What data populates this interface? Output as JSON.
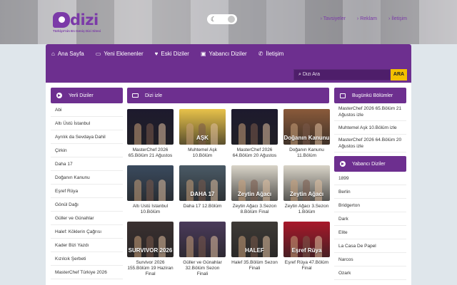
{
  "header": {
    "logo_text": "dizi",
    "logo_tagline": "Türkiye'nin En Geniş Dizi Sitesi",
    "top_links": [
      "Tavsiyeler",
      "Reklam",
      "İletişim"
    ]
  },
  "nav": {
    "items": [
      {
        "label": "Ana Sayfa",
        "icon": "home-icon"
      },
      {
        "label": "Yeni Eklenenler",
        "icon": "monitor-icon"
      },
      {
        "label": "Eski Diziler",
        "icon": "heart-icon"
      },
      {
        "label": "Yabancı Diziler",
        "icon": "camera-icon"
      },
      {
        "label": "İletişim",
        "icon": "phone-icon"
      }
    ],
    "search_placeholder": "Dizi Ara",
    "search_button": "ARA"
  },
  "left_sidebar": {
    "title": "Yerli Diziler",
    "items": [
      "Abi",
      "Altı Üstü İstanbul",
      "Ayrılık da Sevdaya Dahil",
      "Çirkin",
      "Daha 17",
      "Doğanın Kanunu",
      "Eşref Rüya",
      "Gönül Dağı",
      "Güller ve Günahlar",
      "Halef: Köklerin Çağrısı",
      "Kader Bizi Yazdı",
      "Kızılcık Şerbeti",
      "MasterChef Türkiye 2026"
    ]
  },
  "center": {
    "title": "Dizi izle",
    "cards": [
      {
        "title": "MasterChef 2026 65.Bölüm 21 Ağustos",
        "thumb_text": "",
        "color": "#1d1a2e"
      },
      {
        "title": "Muhtemel Aşk 10.Bölüm",
        "thumb_text": "AŞK",
        "color": "#e8c24a"
      },
      {
        "title": "MasterChef 2026 64.Bölüm 20 Ağustos",
        "thumb_text": "",
        "color": "#1d1a2e"
      },
      {
        "title": "Doğanın Kanunu 11.Bölüm",
        "thumb_text": "Doğanın Kanunu",
        "color": "#8a5a3a"
      },
      {
        "title": "Altı Üstü İstanbul 10.Bölüm",
        "thumb_text": "",
        "color": "#3a4a5e"
      },
      {
        "title": "Daha 17 12.Bölüm",
        "thumb_text": "DAHA 17",
        "color": "#4a5a66"
      },
      {
        "title": "Zeytin Ağacı 3.Sezon 8.Bölüm Final",
        "thumb_text": "Zeytin Ağacı",
        "color": "#d9d4c8"
      },
      {
        "title": "Zeytin Ağacı 3.Sezon 1.Bölüm",
        "thumb_text": "Zeytin Ağacı",
        "color": "#d9d4c8"
      },
      {
        "title": "Survivor 2026 155.Bölüm 19 Haziran Final",
        "thumb_text": "SURVIVOR 2026",
        "color": "#3a3030"
      },
      {
        "title": "Güller ve Günahlar 32.Bölüm Sezon Finali",
        "thumb_text": "",
        "color": "#4a3a5a"
      },
      {
        "title": "Halef 35.Bölüm Sezon Finali",
        "thumb_text": "HALEF",
        "color": "#3e3a36"
      },
      {
        "title": "Eşref Rüya 47.Bölüm Final",
        "thumb_text": "Eşref Rüya",
        "color": "#a8182a"
      }
    ]
  },
  "right_sidebar": {
    "episodes_title": "Bugünkü Bölümler",
    "episodes": [
      "MasterChef 2026 65.Bölüm 21 Ağustos izle",
      "Muhtemel Aşk 10.Bölüm izle",
      "MasterChef 2026 64.Bölüm 20 Ağustos izle"
    ],
    "foreign_title": "Yabancı Diziler",
    "foreign": [
      "1899",
      "Berlin",
      "Bridgerton",
      "Dark",
      "Elite",
      "La Casa De Papel",
      "Narcos",
      "Ozark"
    ]
  }
}
